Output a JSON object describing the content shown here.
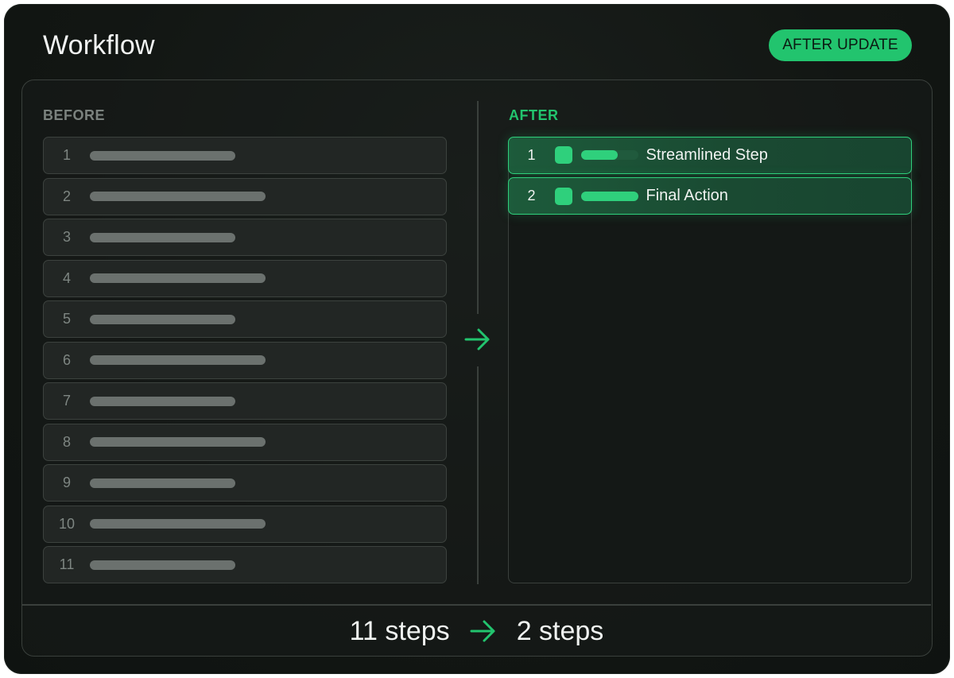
{
  "header": {
    "title": "Workflow",
    "badge": "AFTER UPDATE"
  },
  "before": {
    "label": "BEFORE",
    "steps": [
      "1",
      "2",
      "3",
      "4",
      "5",
      "6",
      "7",
      "8",
      "9",
      "10",
      "11"
    ]
  },
  "after": {
    "label": "AFTER",
    "steps": [
      {
        "number": "1",
        "label": "Streamlined Step",
        "progress": 0.65
      },
      {
        "number": "2",
        "label": "Final Action",
        "progress": 1.0
      }
    ]
  },
  "summary": {
    "before_count": "11 steps",
    "after_count": "2 steps"
  },
  "colors": {
    "accent": "#22c46e",
    "background": "#121613"
  },
  "icons": {
    "transition_arrow": "arrow-right-icon"
  }
}
